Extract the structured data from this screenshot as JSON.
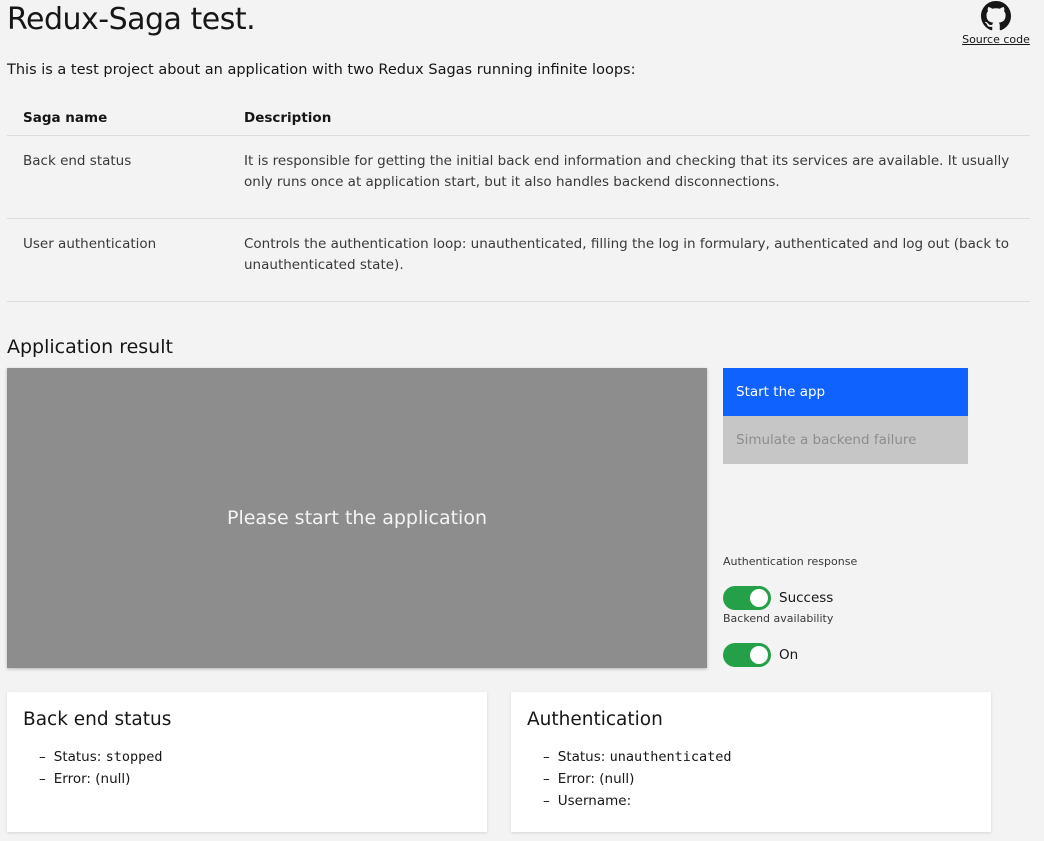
{
  "header": {
    "title": "Redux-Saga test.",
    "source_label": "Source code",
    "source_icon": "github-icon"
  },
  "intro": "This is a test project about an application with two Redux Sagas running infinite loops:",
  "sagas_table": {
    "headers": [
      "Saga name",
      "Description"
    ],
    "rows": [
      {
        "name": "Back end status",
        "description": "It is responsible for getting the initial back end information and checking that its services are available. It usually only runs once at application start, but it also handles backend disconnections."
      },
      {
        "name": "User authentication",
        "description": "Controls the authentication loop: unauthenticated, filling the log in formulary, authenticated and log out (back to unauthenticated state)."
      }
    ]
  },
  "app_result": {
    "title": "Application result",
    "placeholder": "Please start the application",
    "start_button": "Start the app",
    "failure_button": "Simulate a backend failure",
    "auth_response": {
      "label": "Authentication response",
      "state": "Success",
      "on": true
    },
    "backend_availability": {
      "label": "Backend availability",
      "state": "On",
      "on": true
    }
  },
  "backend_card": {
    "title": "Back end status",
    "status_label": "Status:",
    "status_value": "stopped",
    "error_label": "Error:",
    "error_value": "(null)"
  },
  "auth_card": {
    "title": "Authentication",
    "status_label": "Status:",
    "status_value": "unauthenticated",
    "error_label": "Error:",
    "error_value": "(null)",
    "username_label": "Username:",
    "username_value": ""
  },
  "colors": {
    "primary": "#0f62fe",
    "toggle_on": "#24a148",
    "app_area_bg": "#8d8d8d",
    "disabled_bg": "#c6c6c6"
  }
}
